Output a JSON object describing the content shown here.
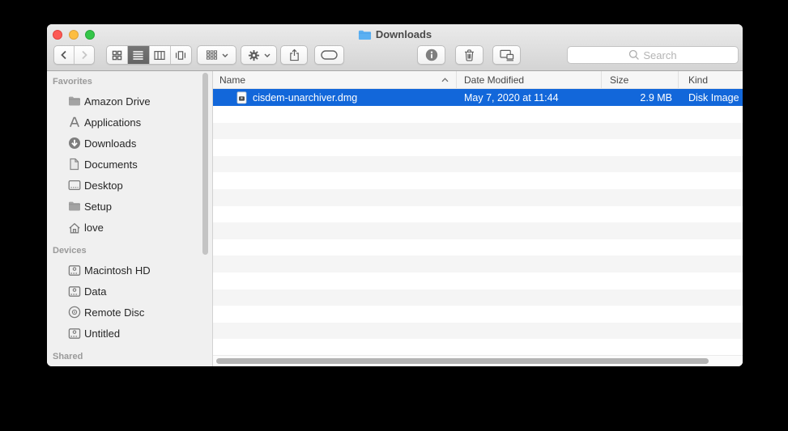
{
  "window": {
    "title": "Downloads",
    "title_icon": "blue-folder-icon"
  },
  "toolbar": {
    "search_placeholder": "Search",
    "icons": [
      "back-icon",
      "forward-icon",
      "icon-view-icon",
      "list-view-icon",
      "column-view-icon",
      "coverflow-view-icon",
      "arrange-icon",
      "gear-icon",
      "share-icon",
      "tag-icon",
      "info-icon",
      "trash-icon",
      "connected-screens-icon",
      "search-icon"
    ],
    "selected_view": "list-view"
  },
  "sidebar": {
    "sections": [
      {
        "label": "Favorites",
        "items": [
          {
            "label": "Amazon Drive",
            "icon": "folder-icon"
          },
          {
            "label": "Applications",
            "icon": "applications-icon"
          },
          {
            "label": "Downloads",
            "icon": "downloads-icon"
          },
          {
            "label": "Documents",
            "icon": "documents-icon"
          },
          {
            "label": "Desktop",
            "icon": "desktop-icon"
          },
          {
            "label": "Setup",
            "icon": "folder-icon"
          },
          {
            "label": "love",
            "icon": "home-icon"
          }
        ]
      },
      {
        "label": "Devices",
        "items": [
          {
            "label": "Macintosh HD",
            "icon": "hard-drive-icon"
          },
          {
            "label": "Data",
            "icon": "hard-drive-icon"
          },
          {
            "label": "Remote Disc",
            "icon": "disc-icon"
          },
          {
            "label": "Untitled",
            "icon": "hard-drive-icon"
          }
        ]
      },
      {
        "label": "Shared",
        "items": []
      }
    ]
  },
  "file_list": {
    "columns": [
      {
        "label": "Name",
        "sort": "ascending"
      },
      {
        "label": "Date Modified"
      },
      {
        "label": "Size"
      },
      {
        "label": "Kind"
      }
    ],
    "rows": [
      {
        "icon": "dmg-file-icon",
        "name": "cisdem-unarchiver.dmg",
        "date_modified": "May 7, 2020 at 11:44",
        "size": "2.9 MB",
        "kind": "Disk Image",
        "selected": true
      }
    ]
  },
  "colors": {
    "selection_blue": "#1267da",
    "folder_blue": "#5bb0f2",
    "titlebar_top": "#ebebeb",
    "titlebar_bottom": "#d4d4d4",
    "sidebar_bg": "#f0f0f0",
    "stripe_gray": "#f5f5f5"
  }
}
